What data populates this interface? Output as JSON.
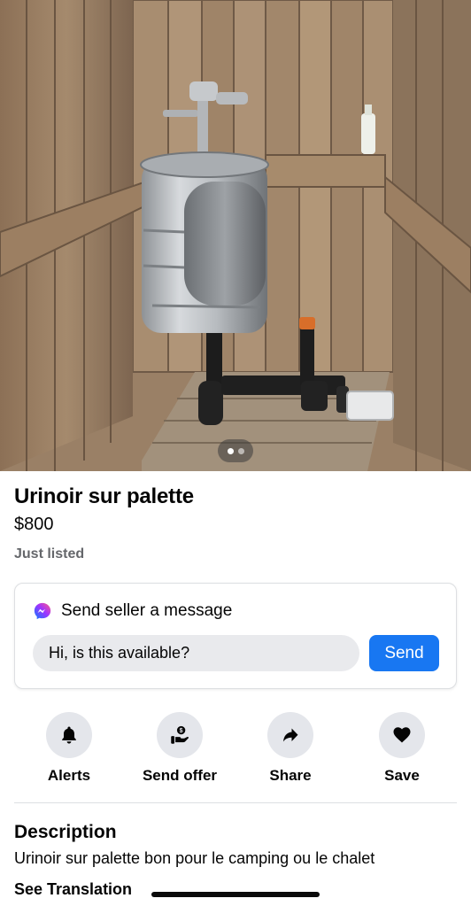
{
  "listing": {
    "title": "Urinoir sur palette",
    "price": "$800",
    "status": "Just listed"
  },
  "photo": {
    "description_icon": "photo",
    "pager": {
      "count": 2,
      "active_index": 0
    }
  },
  "message": {
    "icon": "messenger-icon",
    "heading": "Send seller a message",
    "input_value": "Hi, is this available?",
    "send_label": "Send",
    "send_color": "#1877f2"
  },
  "actions": [
    {
      "icon": "bell-icon",
      "label": "Alerts"
    },
    {
      "icon": "send-offer-icon",
      "label": "Send offer"
    },
    {
      "icon": "share-icon",
      "label": "Share"
    },
    {
      "icon": "heart-icon",
      "label": "Save"
    }
  ],
  "description": {
    "heading": "Description",
    "text": "Urinoir sur palette bon pour le camping ou le chalet",
    "see_translation": "See Translation"
  }
}
